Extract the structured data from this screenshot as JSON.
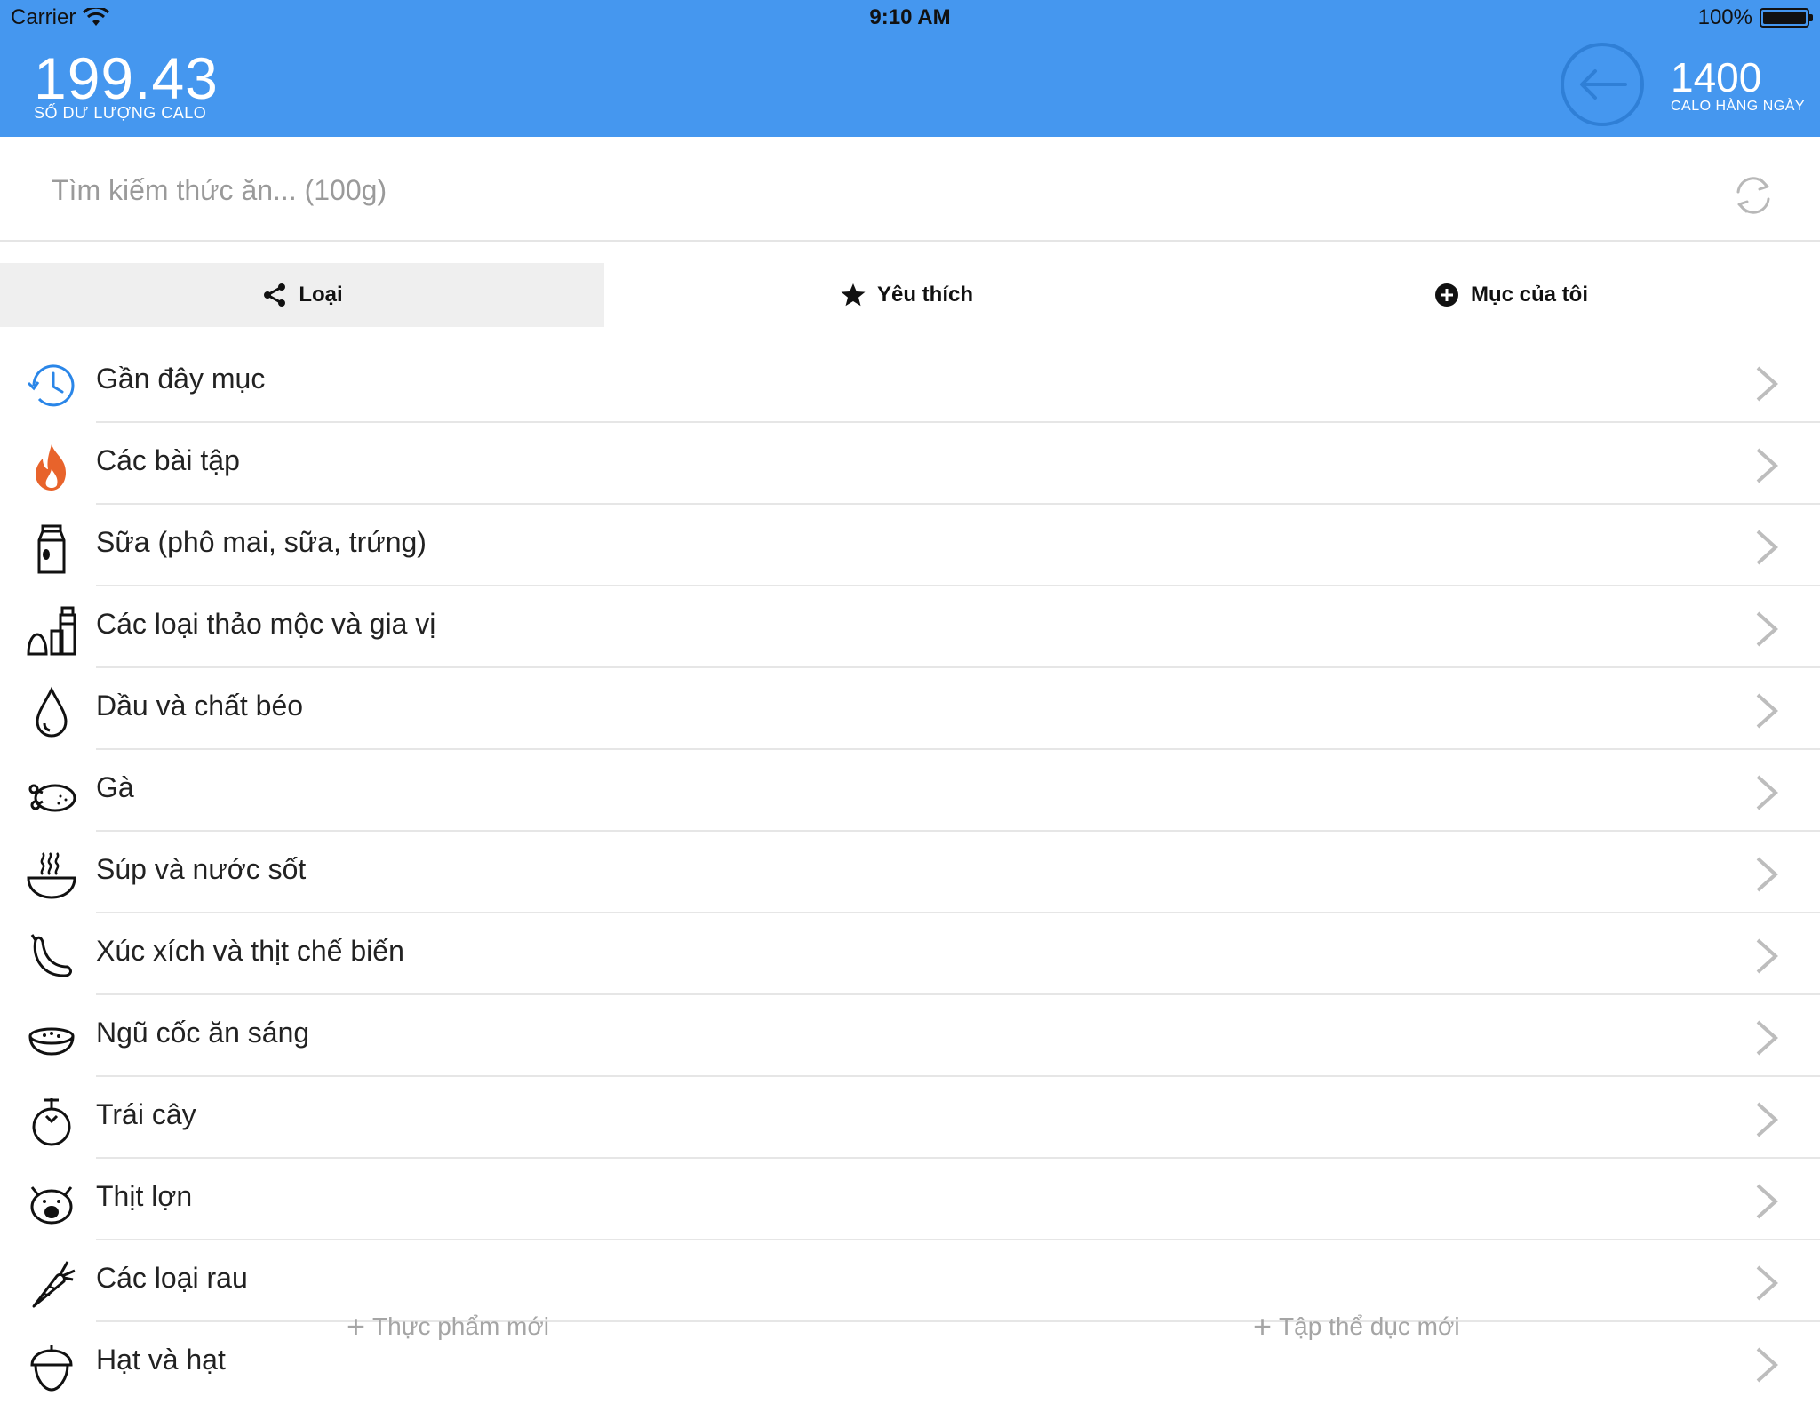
{
  "status_bar": {
    "carrier": "Carrier",
    "time": "9:10 AM",
    "battery": "100%"
  },
  "header": {
    "balance_value": "199.43",
    "balance_label": "SỐ DƯ LƯỢNG CALO",
    "daily_value": "1400",
    "daily_label": "CALO HÀNG NGÀY"
  },
  "search": {
    "placeholder": "Tìm kiếm thức ăn... (100g)",
    "value": ""
  },
  "tabs": [
    {
      "label": "Loại",
      "icon": "share-icon",
      "active": true
    },
    {
      "label": "Yêu thích",
      "icon": "star-icon",
      "active": false
    },
    {
      "label": "Mục của tôi",
      "icon": "plus-circle-icon",
      "active": false
    }
  ],
  "categories": [
    {
      "label": "Gần đây mục",
      "icon": "clock-history-icon"
    },
    {
      "label": "Các bài tập",
      "icon": "fire-icon"
    },
    {
      "label": "Sữa (phô mai, sữa, trứng)",
      "icon": "milk-carton-icon"
    },
    {
      "label": "Các loại thảo mộc và gia vị",
      "icon": "spice-icon"
    },
    {
      "label": "Dầu và chất béo",
      "icon": "drop-icon"
    },
    {
      "label": "Gà",
      "icon": "chicken-icon"
    },
    {
      "label": "Súp và nước sốt",
      "icon": "soup-bowl-icon"
    },
    {
      "label": "Xúc xích và thịt chế biến",
      "icon": "sausage-icon"
    },
    {
      "label": "Ngũ cốc ăn sáng",
      "icon": "cereal-bowl-icon"
    },
    {
      "label": "Trái cây",
      "icon": "fruit-icon"
    },
    {
      "label": "Thịt lợn",
      "icon": "pig-icon"
    },
    {
      "label": "Các loại rau",
      "icon": "carrot-icon"
    },
    {
      "label": "Hạt và hạt",
      "icon": "acorn-icon"
    }
  ],
  "footer": {
    "new_food": "Thực phẩm mới",
    "new_exercise": "Tập thể dục mới"
  },
  "colors": {
    "header_bg": "#4597ef",
    "accent": "#2f7fd6",
    "fire": "#e8632b"
  }
}
